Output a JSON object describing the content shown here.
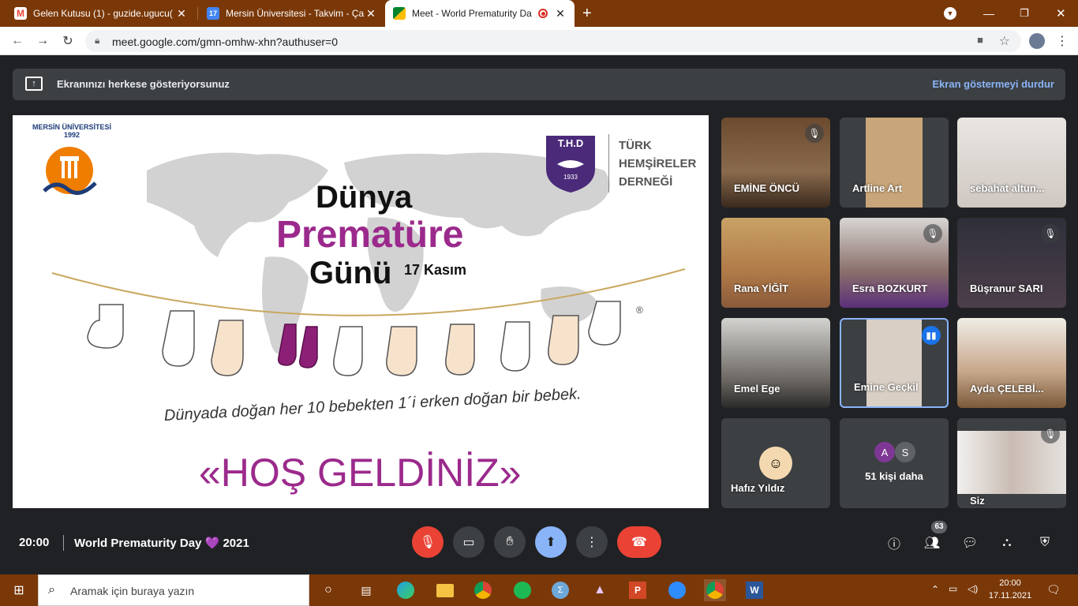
{
  "browser": {
    "tabs": [
      {
        "title": "Gelen Kutusu (1) - guzide.ugucu(",
        "favicon": "gmail-icon",
        "active": false
      },
      {
        "title": "Mersin Üniversitesi - Takvim - Ça",
        "favicon": "calendar-icon",
        "active": false
      },
      {
        "title": "Meet - World Prematurity Da",
        "favicon": "meet-icon",
        "active": true
      }
    ],
    "url": "meet.google.com/gmn-omhw-xhn?authuser=0"
  },
  "banner": {
    "text": "Ekranınızı herkese gösteriyorsunuz",
    "stop_label": "Ekran göstermeyi durdur"
  },
  "slide": {
    "line1": "Dünya",
    "line2": "Prematüre",
    "line3": "Günü",
    "date": "17 Kasım",
    "org_line1": "TÜRK",
    "org_line2": "HEMŞİRELER",
    "org_line3": "DERNEĞİ",
    "org_abbr": "T.H.D",
    "org_year": "1933",
    "univ_name": "MERSİN ÜNİVERSİTESİ 1992",
    "tagline": "Dünyada doğan her 10 bebekten 1´i erken doğan bir bebek.",
    "welcome": "«HOŞ GELDİNİZ»",
    "registered": "®"
  },
  "participants": [
    {
      "name": "EMİNE ÖNCÜ",
      "muted": true
    },
    {
      "name": "Artline Art",
      "muted": false
    },
    {
      "name": "sebahat altun...",
      "muted": false
    },
    {
      "name": "Rana YİĞİT",
      "muted": false
    },
    {
      "name": "Esra BOZKURT",
      "muted": true
    },
    {
      "name": "Büşranur SARI",
      "muted": true
    },
    {
      "name": "Emel Ege",
      "muted": false
    },
    {
      "name": "Emine Geçkil",
      "muted": false,
      "speaking": true
    },
    {
      "name": "Ayda ÇELEBİ...",
      "muted": false
    },
    {
      "name": "Hafız Yıldız",
      "muted": false
    },
    {
      "name": "Siz",
      "muted": true
    }
  ],
  "more": {
    "label": "51 kişi daha",
    "avatars": [
      "A",
      "S"
    ]
  },
  "bottom": {
    "time": "20:00",
    "meeting_title": "World Prematurity Day 💜 2021",
    "people_count": "63"
  },
  "taskbar": {
    "search_placeholder": "Aramak için buraya yazın",
    "clock_time": "20:00",
    "clock_date": "17.11.2021"
  },
  "colors": {
    "accent_purple": "#9b2a8c",
    "hangup_red": "#ea4335",
    "present_blue": "#8ab4f8",
    "titlebar_brown": "#7a3808"
  }
}
